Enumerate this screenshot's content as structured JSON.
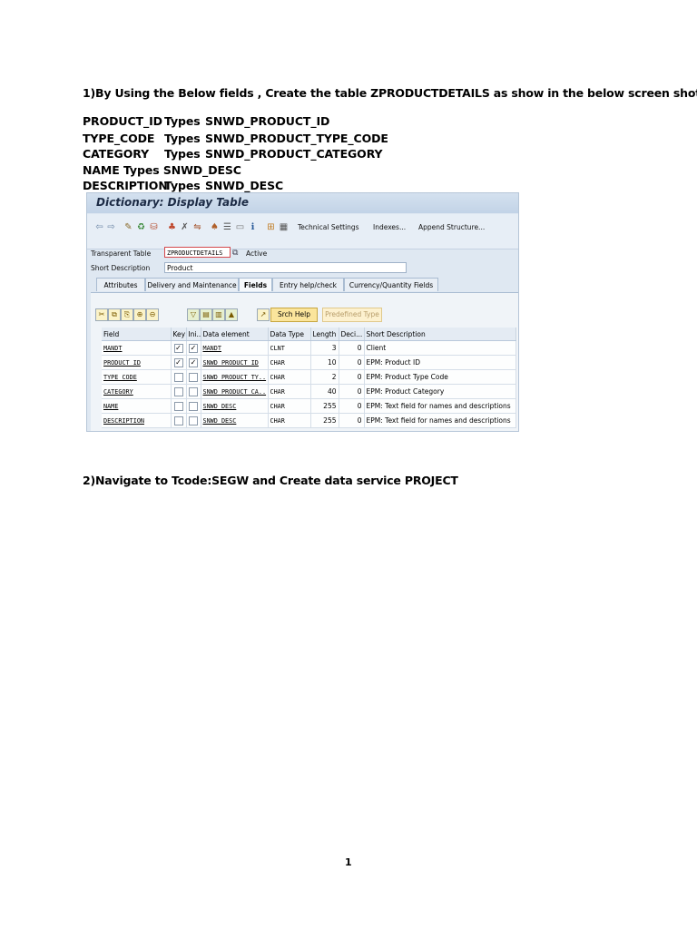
{
  "document": {
    "step1": "1)By Using the Below fields , Create the table ZPRODUCTDETAILS as show in the below screen shot",
    "field_defs": [
      {
        "name": "PRODUCT_ID",
        "types": "Types",
        "data_type": "SNWD_PRODUCT_ID"
      },
      {
        "name": "TYPE_CODE",
        "types": "Types",
        "data_type": "SNWD_PRODUCT_TYPE_CODE"
      },
      {
        "name": "CATEGORY",
        "types": "Types",
        "data_type": "SNWD_PRODUCT_CATEGORY"
      },
      {
        "name": "NAME",
        "types": "Types",
        "data_type": "SNWD_DESC"
      },
      {
        "name": "DESCRIPTION",
        "types": "Types",
        "data_type": "SNWD_DESC"
      }
    ],
    "step2": "2)Navigate to Tcode:SEGW and Create data service PROJECT",
    "page_number": "1"
  },
  "sap": {
    "title": "Dictionary: Display Table",
    "toolbar": {
      "technical_settings": "Technical Settings",
      "indexes": "Indexes...",
      "append_structure": "Append Structure..."
    },
    "header": {
      "transparent_table_label": "Transparent Table",
      "table_name": "ZPRODUCTDETAILS",
      "status": "Active",
      "short_description_label": "Short Description",
      "short_description": "Product"
    },
    "tabs": [
      "Attributes",
      "Delivery and Maintenance",
      "Fields",
      "Entry help/check",
      "Currency/Quantity Fields"
    ],
    "active_tab": "Fields",
    "grid_toolbar": {
      "srch_help": "Srch Help",
      "predefined_type": "Predefined Type"
    },
    "columns": [
      "Field",
      "Key",
      "Ini...",
      "Data element",
      "Data Type",
      "Length",
      "Deci...",
      "Short Description"
    ],
    "rows": [
      {
        "field": "MANDT",
        "key": true,
        "initial": true,
        "data_element": "MANDT",
        "data_type": "CLNT",
        "length": "3",
        "decimals": "0",
        "short_description": "Client"
      },
      {
        "field": "PRODUCT_ID",
        "key": true,
        "initial": true,
        "data_element": "SNWD_PRODUCT_ID",
        "data_type": "CHAR",
        "length": "10",
        "decimals": "0",
        "short_description": "EPM: Product ID"
      },
      {
        "field": "TYPE_CODE",
        "key": false,
        "initial": false,
        "data_element": "SNWD_PRODUCT_TY..",
        "data_type": "CHAR",
        "length": "2",
        "decimals": "0",
        "short_description": "EPM: Product Type Code"
      },
      {
        "field": "CATEGORY",
        "key": false,
        "initial": false,
        "data_element": "SNWD_PRODUCT_CA..",
        "data_type": "CHAR",
        "length": "40",
        "decimals": "0",
        "short_description": "EPM: Product Category"
      },
      {
        "field": "NAME",
        "key": false,
        "initial": false,
        "data_element": "SNWD_DESC",
        "data_type": "CHAR",
        "length": "255",
        "decimals": "0",
        "short_description": "EPM: Text field for names and descriptions"
      },
      {
        "field": "DESCRIPTION",
        "key": false,
        "initial": false,
        "data_element": "SNWD_DESC",
        "data_type": "CHAR",
        "length": "255",
        "decimals": "0",
        "short_description": "EPM: Text field for names and descriptions"
      }
    ]
  }
}
